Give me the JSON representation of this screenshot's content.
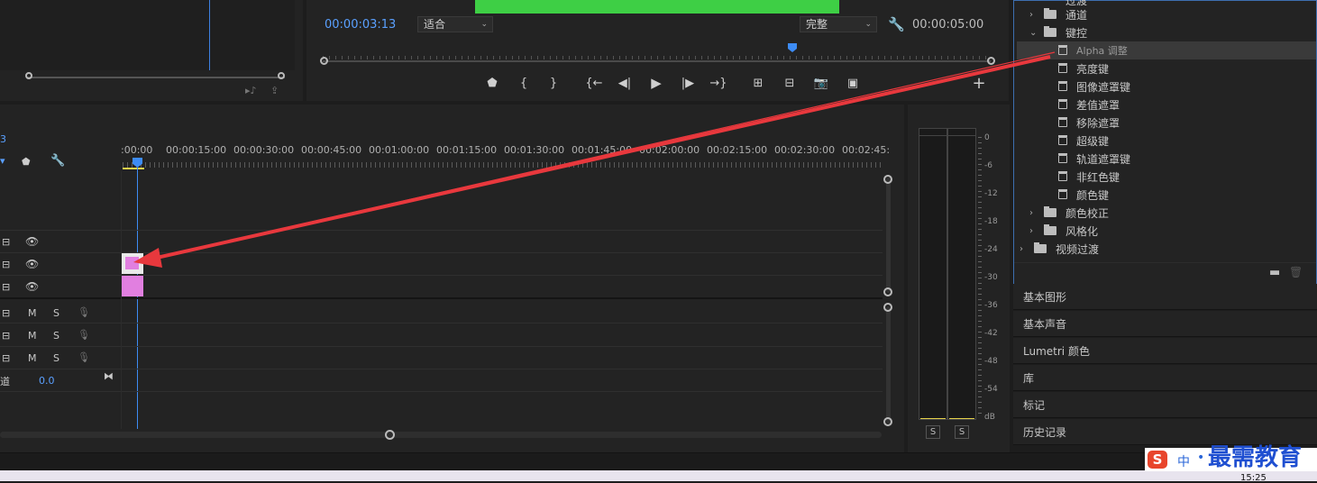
{
  "source_monitor": {},
  "program_monitor": {
    "timecode": "00:00:03:13",
    "fit_select": "适合",
    "quality_select": "完整",
    "duration": "00:00:05:00",
    "preview_color": "#3ecf45"
  },
  "transport": {
    "icons": [
      "marker-icon",
      "mark-in-icon",
      "mark-out-icon",
      "go-to-in-icon",
      "step-back-icon",
      "play-icon",
      "step-forward-icon",
      "go-to-out-icon",
      "lift-icon",
      "extract-icon",
      "export-frame-icon",
      "button-editor-icon"
    ],
    "add_button": "+"
  },
  "timeline": {
    "ruler_labels": [
      ":00:00",
      "00:00:15:00",
      "00:00:30:00",
      "00:00:45:00",
      "00:01:00:00",
      "00:01:15:00",
      "00:01:30:00",
      "00:01:45:00",
      "00:02:00:00",
      "00:02:15:00",
      "00:02:30:00",
      "00:02:45:"
    ],
    "video_tracks": 3,
    "audio_tracks": [
      {
        "m": "M",
        "s": "S"
      },
      {
        "m": "M",
        "s": "S"
      },
      {
        "m": "M",
        "s": "S"
      }
    ],
    "master_label": "道",
    "master_value": "0.0",
    "clip_color": "#e17fe0"
  },
  "audio_meter": {
    "scale": [
      "0",
      "-6",
      "-12",
      "-18",
      "-24",
      "-30",
      "-36",
      "-42",
      "-48",
      "-54",
      "dB"
    ],
    "solo_left": "S",
    "solo_right": "S"
  },
  "effects_tree": {
    "top_partial": "过渡",
    "items": [
      {
        "type": "folder",
        "label": "通道",
        "expanded": false,
        "level": 1
      },
      {
        "type": "folder",
        "label": "键控",
        "expanded": true,
        "level": 1
      },
      {
        "type": "effect",
        "label": "Alpha 调整",
        "selected": true
      },
      {
        "type": "effect",
        "label": "亮度键"
      },
      {
        "type": "effect",
        "label": "图像遮罩键"
      },
      {
        "type": "effect",
        "label": "差值遮罩"
      },
      {
        "type": "effect",
        "label": "移除遮罩"
      },
      {
        "type": "effect",
        "label": "超级键"
      },
      {
        "type": "effect",
        "label": "轨道遮罩键"
      },
      {
        "type": "effect",
        "label": "非红色键"
      },
      {
        "type": "effect",
        "label": "颜色键"
      },
      {
        "type": "folder",
        "label": "颜色校正",
        "expanded": false,
        "level": 1
      },
      {
        "type": "folder",
        "label": "风格化",
        "expanded": false,
        "level": 1
      },
      {
        "type": "folder",
        "label": "视频过渡",
        "expanded": false,
        "level": 0
      }
    ]
  },
  "panels": [
    "基本图形",
    "基本声音",
    "Lumetri 颜色",
    "库",
    "标记",
    "历史记录"
  ],
  "ime": {
    "zh_mode": "中",
    "dot": "•",
    "watermark": "最需教育",
    "clock": "15:25"
  },
  "colors": {
    "accent": "#5aa0ff",
    "arrow": "#e8383d",
    "ime_red": "#e8452c"
  }
}
